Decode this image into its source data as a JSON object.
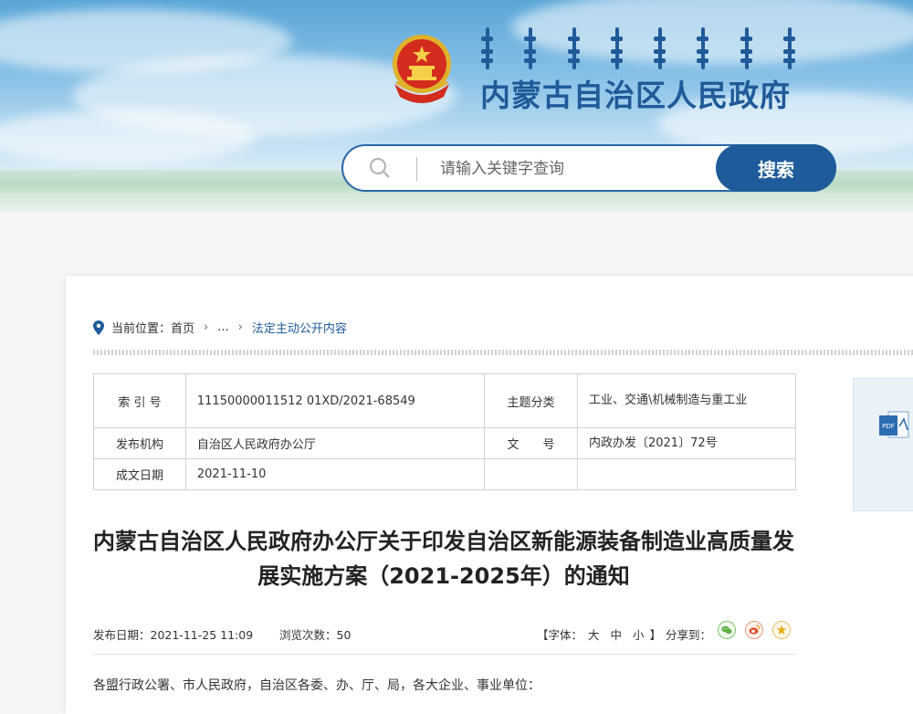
{
  "header": {
    "site_title": "内蒙古自治区人民政府",
    "emblem_icon": "national-emblem-icon",
    "mongolian_script_icon": "mongolian-script-title-icon"
  },
  "search": {
    "placeholder": "请输入关键字查询",
    "button_label": "搜索"
  },
  "breadcrumb": {
    "label": "当前位置：",
    "home": "首页",
    "sep1": "›",
    "ellipsis": "...",
    "sep2": "›",
    "current": "法定主动公开内容"
  },
  "meta_table": {
    "index_label": "索 引 号",
    "index_value": "11150000011512 01XD/2021-68549",
    "topic_label": "主题分类",
    "topic_value": "工业、交通\\机械制造与重工业",
    "publisher_label": "发布机构",
    "publisher_value": "自治区人民政府办公厅",
    "docno_label": "文　　号",
    "docno_value": "内政办发〔2021〕72号",
    "date_label": "成文日期",
    "date_value": "2021-11-10"
  },
  "document": {
    "title": "内蒙古自治区人民政府办公厅关于印发自治区新能源装备制造业高质量发展实施方案（2021-2025年）的通知",
    "publish_date": "发布日期：2021-11-25 11:09",
    "views": "浏览次数：50",
    "font_label_open": "【字体：",
    "font_large": "大",
    "font_medium": "中",
    "font_small": "小",
    "font_label_close": "】",
    "share_label": "分享到：",
    "salutation": "各盟行政公署、市人民政府，自治区各委、办、厅、局，各大企业、事业单位："
  },
  "colors": {
    "brand_blue": "#1e5b9a",
    "title_blue": "#1f5a99"
  }
}
